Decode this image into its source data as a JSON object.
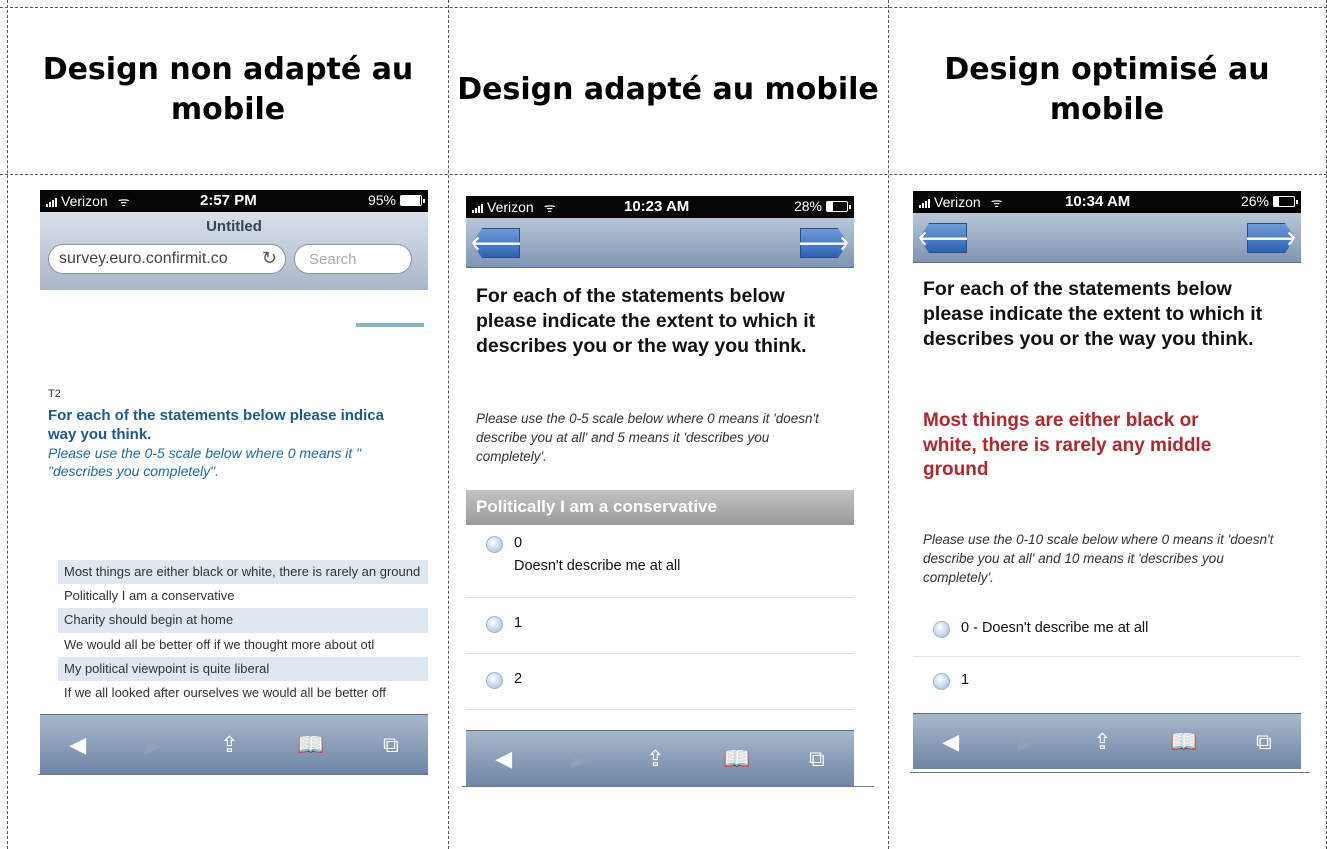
{
  "headers": [
    "Design non adapté au mobile",
    "Design adapté au mobile",
    "Design optimisé au mobile"
  ],
  "status": {
    "carrier": "Verizon",
    "p1": {
      "time": "2:57 PM",
      "battery": "95%"
    },
    "p2": {
      "time": "10:23 AM",
      "battery": "28%"
    },
    "p3": {
      "time": "10:34 AM",
      "battery": "26%"
    }
  },
  "phone1": {
    "page_title": "Untitled",
    "url": "survey.euro.confirmit.co",
    "search_placeholder": "Search",
    "question_id": "T2",
    "question_line1": "For each of the statements below please indica",
    "question_line2": "way you think.",
    "instr_line1": "Please use the 0-5 scale below where 0 means it \"",
    "instr_line2": "\"describes you completely\".",
    "statements": [
      "Most things are either black or white, there is rarely an ground",
      "Politically I am a conservative",
      "Charity should begin at home",
      "We would all be better off if we thought more about otl",
      "My political viewpoint is quite liberal",
      "If we all looked after ourselves we would all be better off"
    ]
  },
  "phone2": {
    "question": "For each of the statements below please indicate the extent to which it describes you or the way you think.",
    "instruction": "Please use the 0-5 scale below where 0 means it 'doesn't describe you at all' and 5 means it 'describes you completely'.",
    "statement": "Politically I am a conservative",
    "options": [
      {
        "value": "0",
        "label": "Doesn't describe me at all"
      },
      {
        "value": "1",
        "label": ""
      },
      {
        "value": "2",
        "label": ""
      }
    ]
  },
  "phone3": {
    "question": "For each of the statements below please indicate the extent to which it describes you or the way you think.",
    "statement": "Most things are either black or white, there is rarely any middle ground",
    "instruction": "Please use the 0-10 scale below where 0 means it 'doesn't describe you at all' and 10 means it 'describes you completely'.",
    "options": [
      "0 - Doesn't describe me at all",
      "1"
    ]
  },
  "icons": {
    "back": "◀",
    "forward": "▶",
    "share": "⇪",
    "bookmarks": "📖",
    "tabs": "⧉",
    "nav_left": "🡐",
    "nav_right": "🡒",
    "reload": "↻",
    "wifi": "ᯤ"
  },
  "colors": {
    "question_red": "#b2262d",
    "question_blue": "#1c5a8f"
  }
}
